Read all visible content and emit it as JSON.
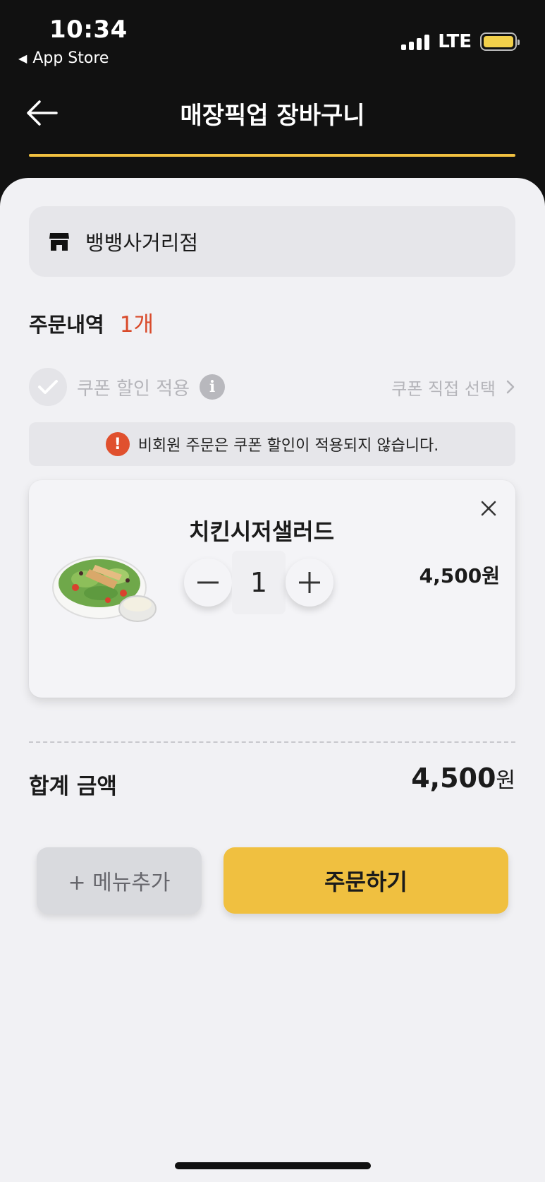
{
  "status_bar": {
    "time": "10:34",
    "back_app_label": "App Store",
    "network": "LTE"
  },
  "header": {
    "title": "매장픽업 장바구니",
    "accent_color": "#f0c040"
  },
  "store": {
    "icon": "store-icon",
    "name": "뱅뱅사거리점"
  },
  "order_summary": {
    "label": "주문내역",
    "count": "1개"
  },
  "coupon": {
    "apply_label": "쿠폰 할인 적용",
    "select_label": "쿠폰 직접 선택",
    "notice": "비회원 주문은 쿠폰 할인이 적용되지 않습니다."
  },
  "cart_items": [
    {
      "name": "치킨시저샐러드",
      "quantity": "1",
      "price": "4,500원"
    }
  ],
  "total": {
    "label": "합계 금액",
    "amount": "4,500",
    "unit": "원"
  },
  "buttons": {
    "add_menu": "+ 메뉴추가",
    "order": "주문하기"
  }
}
